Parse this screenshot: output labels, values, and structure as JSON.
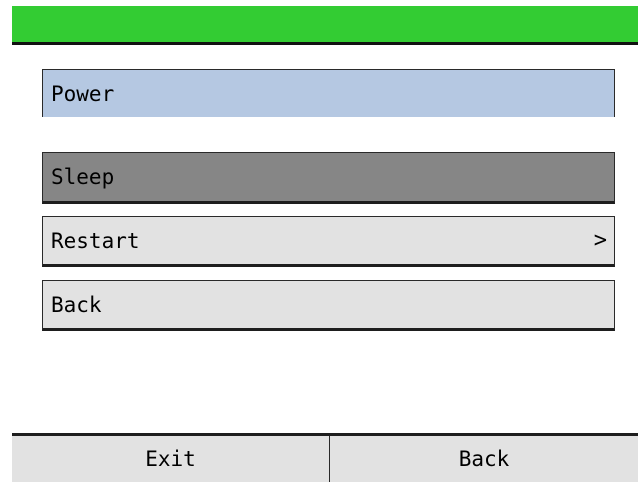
{
  "menu": {
    "title": "Power",
    "items": [
      {
        "label": "Sleep",
        "state": "selected",
        "chevron": ""
      },
      {
        "label": "Restart",
        "state": "normal",
        "chevron": ">"
      },
      {
        "label": "Back",
        "state": "normal",
        "chevron": ""
      }
    ]
  },
  "softkeys": {
    "left": "Exit",
    "right": "Back"
  },
  "colors": {
    "titlebar": "#33cc33",
    "header": "#b5c8e2",
    "selected": "#868686",
    "normal": "#e2e2e2"
  }
}
